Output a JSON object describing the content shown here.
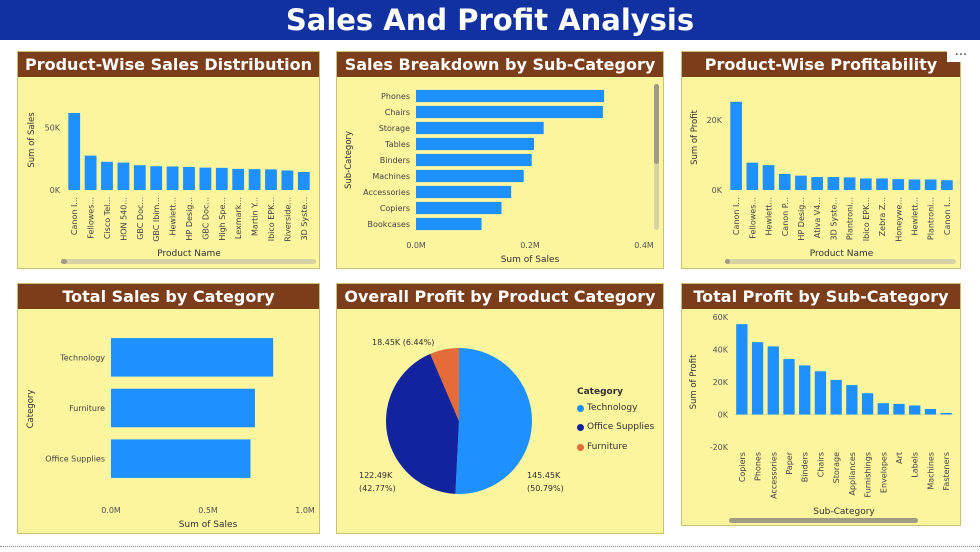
{
  "page": {
    "title": "Sales And Profit Analysis",
    "more_label": "..."
  },
  "colors": {
    "banner": "#1231a0",
    "card_bg": "#fbf59e",
    "card_title_bg": "#7c3d1a",
    "bar": "#1e90ff"
  },
  "charts": {
    "product_sales": {
      "title": "Product-Wise Sales Distribution",
      "chart_data": {
        "type": "bar",
        "title": "Product-Wise Sales Distribution",
        "xlabel": "Product Name",
        "ylabel": "Sum of Sales",
        "ylim": [
          0,
          80000
        ],
        "yticks": [
          0,
          50000
        ],
        "ytick_labels": [
          "0K",
          "50K"
        ],
        "categories": [
          "Canon I...",
          "Fellowes...",
          "Cisco Tel...",
          "HON 540...",
          "GBC Doc...",
          "GBC Ibim...",
          "Hewlett...",
          "HP Desig...",
          "GBC Doc...",
          "High Spe...",
          "Lexmark...",
          "Martin Y...",
          "Ibico EPK...",
          "Riverside...",
          "3D Syste..."
        ],
        "values": [
          61600,
          27500,
          22600,
          21900,
          19800,
          19000,
          18800,
          18400,
          17900,
          17700,
          16900,
          16700,
          16500,
          15600,
          14400
        ]
      }
    },
    "subcategory_sales": {
      "title": "Sales Breakdown by Sub-Category",
      "chart_data": {
        "type": "bar",
        "orientation": "horizontal",
        "title": "Sales Breakdown by Sub-Category",
        "xlabel": "Sum of Sales",
        "ylabel": "Sub-Category",
        "xlim": [
          0,
          400000
        ],
        "xticks": [
          0,
          200000,
          400000
        ],
        "xtick_labels": [
          "0.0M",
          "0.2M",
          "0.4M"
        ],
        "categories": [
          "Phones",
          "Chairs",
          "Storage",
          "Tables",
          "Binders",
          "Machines",
          "Accessories",
          "Copiers",
          "Bookcases"
        ],
        "values": [
          330000,
          328000,
          224000,
          207000,
          203000,
          189000,
          167000,
          150000,
          115000
        ]
      }
    },
    "product_profit": {
      "title": "Product-Wise Profitability",
      "chart_data": {
        "type": "bar",
        "title": "Product-Wise Profitability",
        "xlabel": "Product Name",
        "ylabel": "Sum of Profit",
        "ylim": [
          0,
          30000
        ],
        "yticks": [
          0,
          20000
        ],
        "ytick_labels": [
          "0K",
          "20K"
        ],
        "categories": [
          "Canon I...",
          "Fellowes...",
          "Hewlett...",
          "Canon P...",
          "HP Desig...",
          "Ativa V4...",
          "3D Syste...",
          "Plantroni...",
          "Ibico EPK...",
          "Zebra Z...",
          "Honeywe...",
          "Hewlett...",
          "Plantroni...",
          "Canon I..."
        ],
        "values": [
          25200,
          7800,
          7100,
          4600,
          4100,
          3700,
          3700,
          3600,
          3300,
          3300,
          3100,
          3000,
          3000,
          2800
        ]
      }
    },
    "category_sales": {
      "title": "Total Sales by Category",
      "chart_data": {
        "type": "bar",
        "orientation": "horizontal",
        "title": "Total Sales by Category",
        "xlabel": "Sum of Sales",
        "ylabel": "Category",
        "xlim": [
          0,
          1000000
        ],
        "xticks": [
          0,
          500000,
          1000000
        ],
        "xtick_labels": [
          "0.0M",
          "0.5M",
          "1.0M"
        ],
        "categories": [
          "Technology",
          "Furniture",
          "Office Supplies"
        ],
        "values": [
          836000,
          742000,
          719000
        ]
      }
    },
    "category_profit": {
      "title": "Overall Profit by Product Category",
      "chart_data": {
        "type": "pie",
        "title": "Overall Profit by Product Category",
        "legend_title": "Category",
        "legend_position": "right",
        "categories": [
          "Technology",
          "Office Supplies",
          "Furniture"
        ],
        "values": [
          145450,
          122490,
          18450
        ],
        "percent": [
          50.79,
          42.77,
          6.44
        ],
        "colors": [
          "#1e90ff",
          "#12239e",
          "#e66c37"
        ],
        "data_labels": [
          {
            "value": "145.45K",
            "pct": "(50.79%)"
          },
          {
            "value": "122.49K",
            "pct": "(42.77%)"
          },
          {
            "value": "18.45K (6.44%)",
            "pct": ""
          }
        ]
      }
    },
    "subcategory_profit": {
      "title": "Total Profit by Sub-Category",
      "chart_data": {
        "type": "bar",
        "title": "Total Profit by Sub-Category",
        "xlabel": "Sub-Category",
        "ylabel": "Sum of Profit",
        "ylim": [
          -20000,
          60000
        ],
        "yticks": [
          -20000,
          0,
          20000,
          40000,
          60000
        ],
        "ytick_labels": [
          "-20K",
          "0K",
          "20K",
          "40K",
          "60K"
        ],
        "categories": [
          "Copiers",
          "Phones",
          "Accessories",
          "Paper",
          "Binders",
          "Chairs",
          "Storage",
          "Appliances",
          "Furnishings",
          "Envelopes",
          "Art",
          "Labels",
          "Machines",
          "Fasteners"
        ],
        "values": [
          55600,
          44500,
          41900,
          34100,
          30200,
          26600,
          21300,
          18100,
          13100,
          6960,
          6530,
          5550,
          3380,
          950
        ]
      }
    }
  }
}
